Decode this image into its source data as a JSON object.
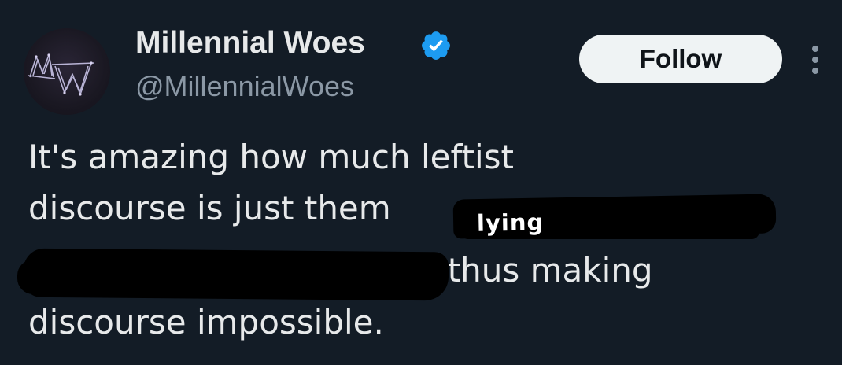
{
  "tweet": {
    "author": {
      "display_name": "Millennial Woes",
      "handle": "@MillennialWoes",
      "verified": true,
      "avatar_icon": "mw-monogram-icon"
    },
    "follow_label": "Follow",
    "more_icon": "more-vertical-icon",
    "text_lines": {
      "line1": "It's amazing how much leftist",
      "line2": "discourse is just them",
      "line3": ", thus making",
      "line4": "discourse impossible."
    },
    "handwritten_overlay": "lying"
  },
  "colors": {
    "background": "#131c26",
    "text_primary": "#e7e9ea",
    "text_secondary": "#8b98a5",
    "verified_blue": "#1d9bf0",
    "follow_bg": "#eff3f4",
    "redaction": "#000000"
  }
}
